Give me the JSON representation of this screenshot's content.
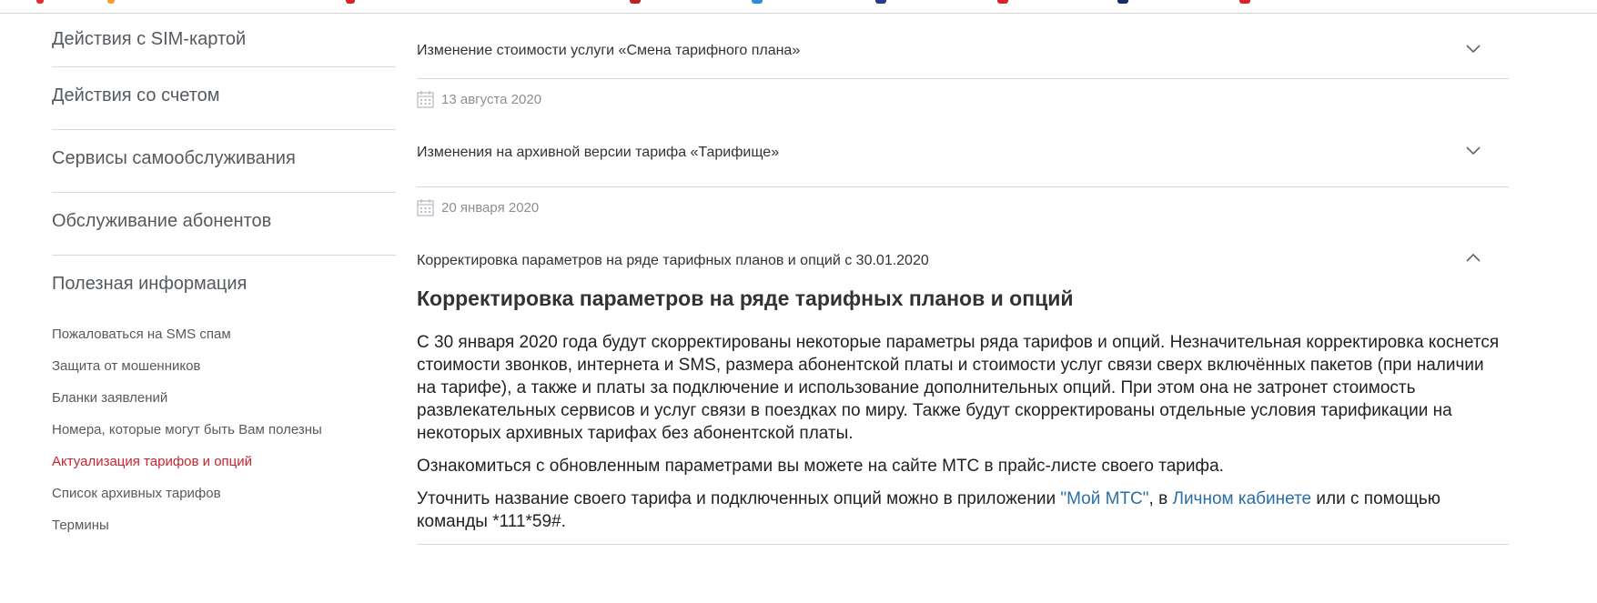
{
  "sidebar": {
    "sections": [
      "Действия с SIM-картой",
      "Действия со счетом",
      "Сервисы самообслуживания",
      "Обслуживание абонентов",
      "Полезная информация"
    ],
    "links": [
      "Пожаловаться на SMS спам",
      "Защита от мошенников",
      "Бланки заявлений",
      "Номера, которые могут быть Вам полезны",
      "Актуализация тарифов и опций",
      "Список архивных тарифов",
      "Термины"
    ]
  },
  "main": {
    "item1_title": "Изменение стоимости услуги «Смена тарифного плана»",
    "date2": "13 августа 2020",
    "item2_title": "Изменения на архивной версии тарифа «Тарифище»",
    "date3": "20 января 2020",
    "item3_title": "Корректировка параметров на ряде тарифных планов и опций с 30.01.2020",
    "article": {
      "title": "Корректировка параметров на ряде тарифных планов и опций",
      "p1": "С 30 января 2020 года будут скорректированы некоторые параметры ряда тарифов и опций. Незначительная корректировка коснется стоимости звонков, интернета и SMS, размера абонентской платы и стоимости услуг связи сверх включённых пакетов (при наличии на тарифе), а также и платы за подключение и использование дополнительных опций. При этом она не затронет стоимость развлекательных сервисов и услуг связи в поездках по миру. Также будут скорректированы отдельные условия тарификации на некоторых архивных тарифах без абонентской платы.",
      "p2": "Ознакомиться с обновленным параметрами вы можете на сайте МТС в прайс-листе своего тарифа.",
      "p3_a": "Уточнить название своего тарифа и подключенных опций можно в приложении ",
      "p3_link1": "\"Мой МТС\"",
      "p3_b": ", в ",
      "p3_link2": "Личном кабинете",
      "p3_c": " или с помощью команды *111*59#."
    }
  }
}
